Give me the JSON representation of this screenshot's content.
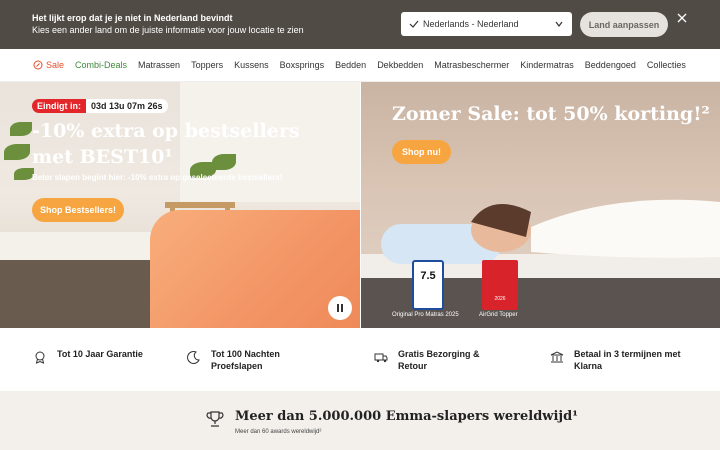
{
  "geo": {
    "title": "Het lijkt erop dat je je niet in Nederland bevindt",
    "subtitle": "Kies een ander land om de juiste informatie voor jouw locatie te zien",
    "selected_country": "Nederlands - Nederland",
    "button": "Land aanpassen"
  },
  "nav": {
    "items": [
      "Sale",
      "Combi-Deals",
      "Matrassen",
      "Toppers",
      "Kussens",
      "Boxsprings",
      "Bedden",
      "Dekbedden",
      "Matrasbeschermer",
      "Kindermatras",
      "Beddengoed",
      "Collecties"
    ]
  },
  "hero_left": {
    "timer_label": "Eindigt in:",
    "timer_value": "03d 13u 07m 26s",
    "title": "-10% extra op bestsellers met BEST10¹",
    "subtitle": "Beter slapen begint hier: -10% extra op geselecteerde bestsellers!",
    "cta": "Shop Bestsellers!"
  },
  "hero_right": {
    "title": "Zomer Sale: tot 50% korting!²",
    "cta": "Shop nu!",
    "badge1_score": "7.5",
    "badge1_caption": "Original Pro Matras 2025",
    "badge2_year": "2026",
    "badge2_caption": "AirGrid Topper"
  },
  "usps": [
    {
      "text": "Tot 10 Jaar Garantie"
    },
    {
      "text": "Tot 100 Nachten Proefslapen"
    },
    {
      "text": "Gratis Bezorging & Retour"
    },
    {
      "text": "Betaal in 3 termijnen met Klarna"
    }
  ],
  "awards": {
    "title": "Meer dan 5.000.000 Emma-slapers wereldwijd¹",
    "subtitle": "Meer dan 60 awards wereldwijd²"
  },
  "colors": {
    "geo_bg": "#514b46",
    "cta": "#f7a540",
    "sale": "#e4502c",
    "timer": "#e3262a"
  }
}
